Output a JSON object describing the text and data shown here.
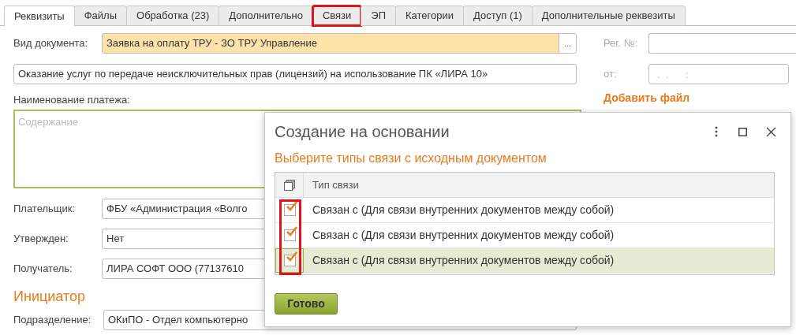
{
  "tabs": [
    {
      "label": "Реквизиты",
      "selected": true,
      "highlighted": false
    },
    {
      "label": "Файлы",
      "selected": false,
      "highlighted": false
    },
    {
      "label": "Обработка (23)",
      "selected": false,
      "highlighted": false
    },
    {
      "label": "Дополнительно",
      "selected": false,
      "highlighted": false
    },
    {
      "label": "Связи",
      "selected": false,
      "highlighted": true
    },
    {
      "label": "ЭП",
      "selected": false,
      "highlighted": false
    },
    {
      "label": "Категории",
      "selected": false,
      "highlighted": false
    },
    {
      "label": "Доступ (1)",
      "selected": false,
      "highlighted": false
    },
    {
      "label": "Дополнительные реквезиты",
      "selected": false,
      "highlighted": false
    }
  ],
  "form": {
    "doc_type": {
      "label": "Вид документа:",
      "value": "Заявка на оплату ТРУ - ЗО ТРУ Управление",
      "button": "..."
    },
    "subject": "Оказание услуг по передаче неисключительных прав (лицензий) на использование ПК «ЛИРА 10»",
    "payment_name": {
      "label": "Наименование платежа:",
      "placeholder": "Содержание"
    },
    "fields": [
      {
        "label": "Плательщик:",
        "value": "ФБУ «Администрация «Волго"
      },
      {
        "label": "Утвержден:",
        "value": "Нет"
      },
      {
        "label": "Получатель:",
        "value": "ЛИРА СОФТ ООО (77137610"
      }
    ],
    "initiator": {
      "heading": "Инициатор",
      "label": "Подразделение:",
      "value": "ОКиПО - Отдел компьютерно"
    },
    "reg_no": {
      "label": "Рег. №:"
    },
    "date": {
      "label": "от:",
      "placeholder": ".  .      :"
    },
    "add_file": "Добавить файл"
  },
  "dialog": {
    "title": "Создание на основании",
    "subtitle": "Выберите типы связи с исходным документом",
    "checkbox_column_highlighted": true,
    "column": "Тип связи",
    "rows": [
      {
        "label": "Связан с (Для связи внутренних документов между собой)",
        "checked": true,
        "selected": false
      },
      {
        "label": "Связан с (Для связи внутренних документов между собой)",
        "checked": true,
        "selected": false
      },
      {
        "label": "Связан с (Для связи внутренних документов между собой)",
        "checked": true,
        "selected": true
      }
    ],
    "button": "Готово"
  }
}
